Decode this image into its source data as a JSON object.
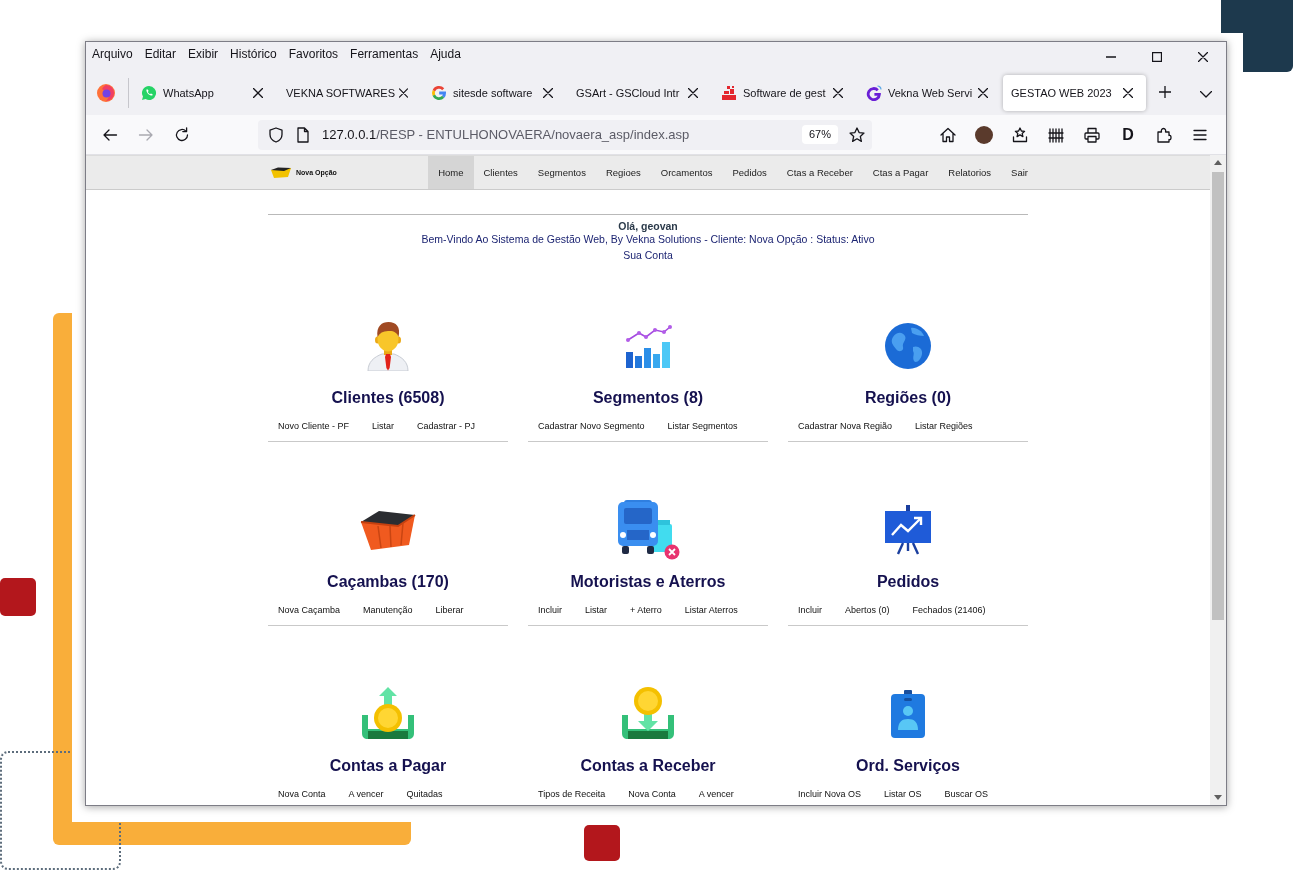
{
  "window": {
    "menu": [
      "Arquivo",
      "Editar",
      "Exibir",
      "Histórico",
      "Favoritos",
      "Ferramentas",
      "Ajuda"
    ]
  },
  "tabs": [
    {
      "label": "WhatsApp",
      "selected": false
    },
    {
      "label": "VEKNA SOFTWARES",
      "selected": false
    },
    {
      "label": "sitesde software",
      "selected": false
    },
    {
      "label": "GSArt - GSCloud Intr",
      "selected": false
    },
    {
      "label": "Software de gest",
      "selected": false
    },
    {
      "label": "Vekna Web Servi",
      "selected": false
    },
    {
      "label": "GESTAO WEB 2023",
      "selected": true
    }
  ],
  "toolbar": {
    "nav_buttons": [
      {
        "disabled": false
      },
      {
        "disabled": true
      },
      {
        "disabled": false
      }
    ],
    "url_host": "127.0.0.1",
    "url_path": "/RESP - ENTULHONOVAERA/novaera_asp/index.asp",
    "zoom": "67%",
    "extension_label": "D"
  },
  "site": {
    "logo_text": "Nova Opção",
    "nav": [
      {
        "label": "Home",
        "selected": true
      },
      {
        "label": "Clientes",
        "selected": false
      },
      {
        "label": "Segmentos",
        "selected": false
      },
      {
        "label": "Regioes",
        "selected": false
      },
      {
        "label": "Orcamentos",
        "selected": false
      },
      {
        "label": "Pedidos",
        "selected": false
      },
      {
        "label": "Ctas a Receber",
        "selected": false
      },
      {
        "label": "Ctas a Pagar",
        "selected": false
      },
      {
        "label": "Relatorios",
        "selected": false
      },
      {
        "label": "Sair",
        "selected": false
      }
    ],
    "greeting": "Olá, geovan",
    "welcome": "Bem-Vindo Ao Sistema de Gestão Web, By Vekna Solutions - Cliente: Nova Opção : Status: Ativo",
    "account_link": "Sua Conta",
    "modules": [
      {
        "title": "Clientes (6508)",
        "links": [
          "Novo Cliente - PF",
          "Listar",
          "Cadastrar - PJ"
        ]
      },
      {
        "title": "Segmentos (8)",
        "links": [
          "Cadastrar Novo Segmento",
          "Listar Segmentos"
        ]
      },
      {
        "title": "Regiões (0)",
        "links": [
          "Cadastrar Nova Região",
          "Listar Regiões"
        ]
      },
      {
        "title": "Caçambas (170)",
        "links": [
          "Nova Caçamba",
          "Manutenção",
          "Liberar"
        ]
      },
      {
        "title": "Motoristas e Aterros",
        "links": [
          "Incluir",
          "Listar",
          "+ Aterro",
          "Listar Aterros"
        ]
      },
      {
        "title": "Pedidos",
        "links": [
          "Incluir",
          "Abertos (0)",
          "Fechados (21406)"
        ]
      },
      {
        "title": "Contas a Pagar",
        "links": [
          "Nova Conta",
          "A vencer",
          "Quitadas"
        ]
      },
      {
        "title": "Contas a Receber",
        "links": [
          "Tipos de Receita",
          "Nova Conta",
          "A vencer"
        ]
      },
      {
        "title": "Ord. Serviços",
        "links": [
          "Incluir Nova OS",
          "Listar OS",
          "Buscar OS"
        ]
      }
    ]
  }
}
